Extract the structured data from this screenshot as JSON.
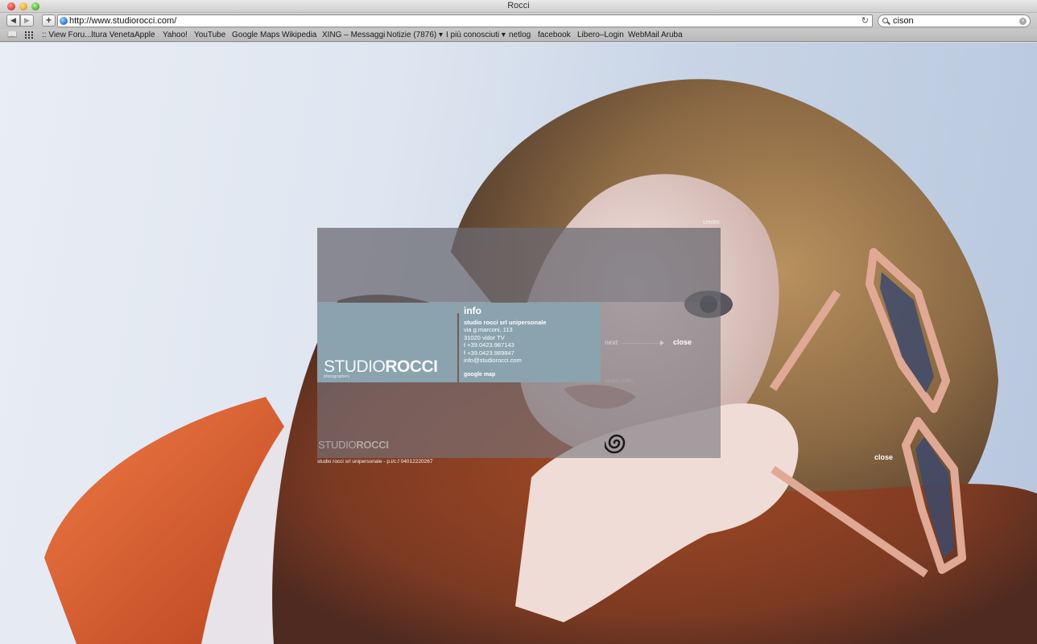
{
  "window": {
    "title": "Rocci"
  },
  "toolbar": {
    "back_label": "◀",
    "forward_label": "▶",
    "add_label": "+",
    "url": "http://www.studiorocci.com/",
    "search_value": "cison"
  },
  "bookmarks": [
    ":: View Foru...ltura Veneta",
    "Apple",
    "Yahoo!",
    "YouTube",
    "Google Maps",
    "Wikipedia",
    "XING – Messaggi",
    "Notizie (7876) ▾",
    "I più conosciuti ▾",
    "netlog",
    "facebook",
    "Libero–Login",
    "WebMail Aruba"
  ],
  "site": {
    "credits": "credits",
    "logo_light": "STUDIO",
    "logo_bold": "ROCCI",
    "logo_sub": "photographers",
    "info": {
      "title": "info",
      "company": "studio rocci srl unipersonale",
      "address": "via g.marconi, 113",
      "city": "31020 vidor TV",
      "phone": "t +39.0423.987143",
      "fax": "f +39.0423.989847",
      "email": "info@studiorocci.com",
      "map_link": "google map"
    },
    "next": "next",
    "close": "close",
    "crumb": "studio | info |",
    "footer": "studio rocci srl unipersonale - p.i/c.f 04012220267",
    "close_outer": "close"
  },
  "colors": {
    "info_panel": "#8aa3ae",
    "fur": "#8a3f24",
    "cushion": "#e1592a"
  }
}
